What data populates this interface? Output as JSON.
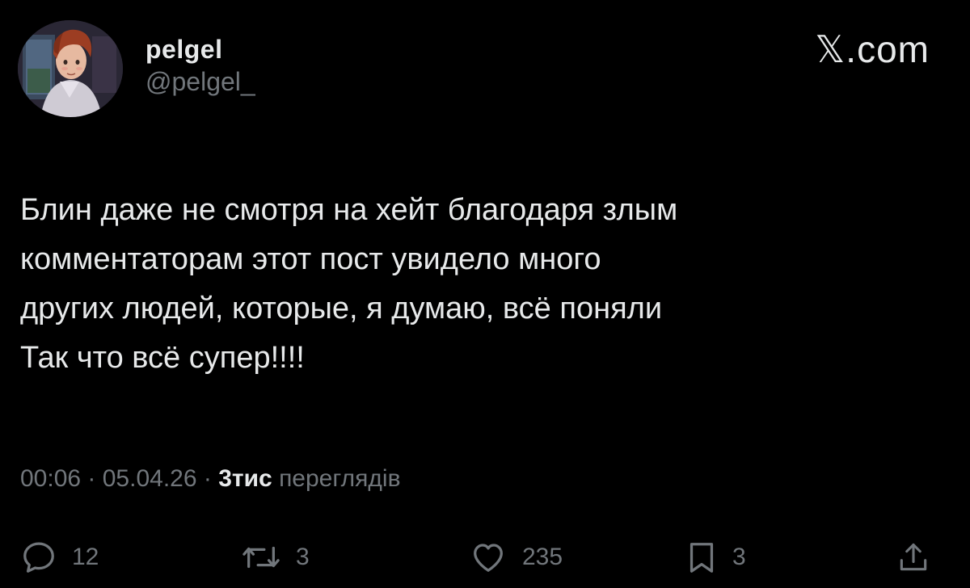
{
  "author": {
    "display_name": "pelgel",
    "handle": "@pelgel_"
  },
  "brand": {
    "label": "𝕏.com"
  },
  "tweet": {
    "lines": [
      "Блин даже не смотря на хейт благодаря злым",
      "комментаторам этот пост увидело много",
      "других людей, которые, я думаю, всё поняли",
      "Так что всё супер!!!!"
    ]
  },
  "meta": {
    "time": "00:06",
    "separator": " · ",
    "date": "05.04.26",
    "views_count": "3тис",
    "views_label": "переглядів"
  },
  "actions": {
    "replies": "12",
    "reposts": "3",
    "likes": "235",
    "bookmarks": "3"
  },
  "colors": {
    "background": "#000000",
    "primary_text": "#e7e9ea",
    "secondary_text": "#71767b"
  },
  "icons": {
    "reply": "speech-bubble-icon",
    "repost": "repost-arrows-icon",
    "like": "heart-icon",
    "bookmark": "bookmark-icon",
    "share": "share-upload-icon"
  }
}
